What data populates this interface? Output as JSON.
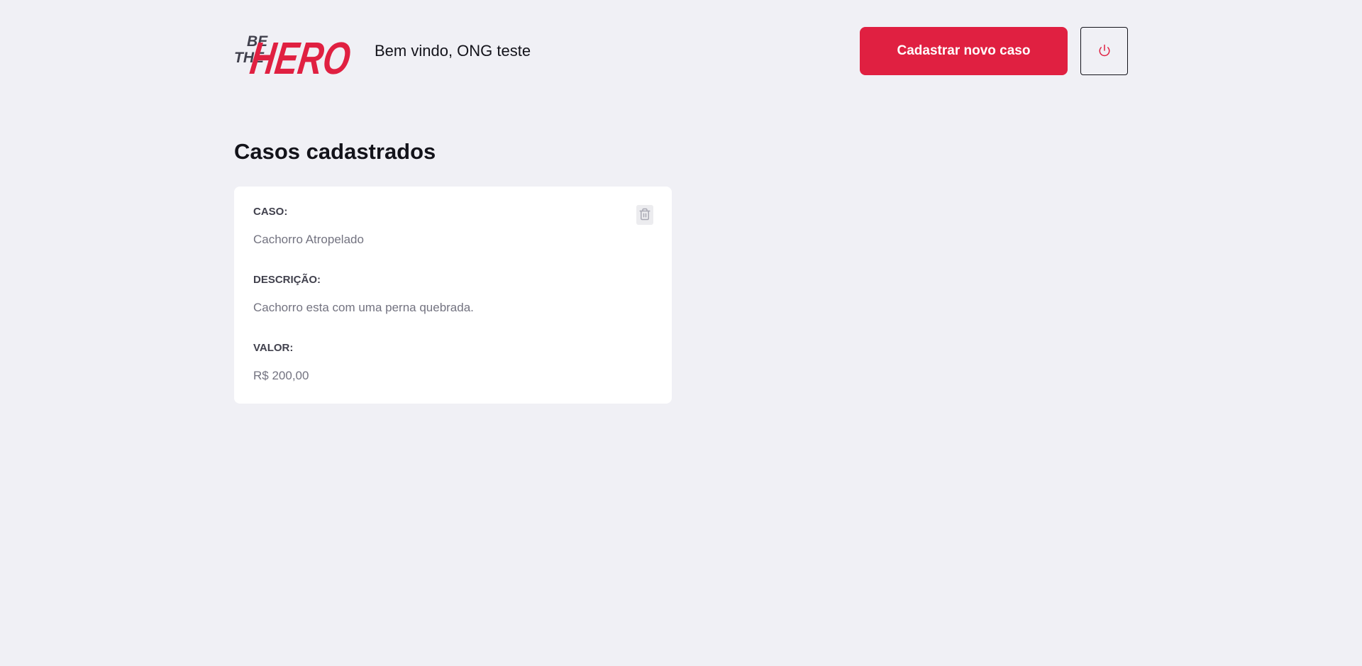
{
  "header": {
    "logo": {
      "line1": "BE",
      "line2": "THE",
      "word": "HERO",
      "primary_color": "#e02041",
      "secondary_color": "#41414d"
    },
    "welcome_text": "Bem vindo, ONG teste",
    "new_case_label": "Cadastrar novo caso",
    "logout_icon": "power-icon"
  },
  "main": {
    "title": "Casos cadastrados",
    "cases": [
      {
        "case_label": "CASO:",
        "case_value": "Cachorro Atropelado",
        "description_label": "DESCRIÇÃO:",
        "description_value": "Cachorro esta com uma perna quebrada.",
        "value_label": "VALOR:",
        "value_value": "R$ 200,00",
        "delete_icon": "trash-icon"
      }
    ]
  },
  "colors": {
    "background": "#f0f0f5",
    "accent": "#e02041",
    "text_dark": "#13131a",
    "label": "#41414d",
    "muted": "#737380",
    "card": "#ffffff"
  }
}
